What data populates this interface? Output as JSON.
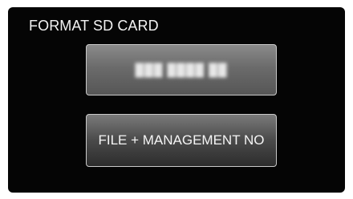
{
  "screen": {
    "title": "FORMAT SD CARD"
  },
  "menu": {
    "option_top": {
      "label": "███ ████ ██",
      "obscured": true
    },
    "option_bottom": {
      "label": "FILE + MANAGEMENT NO"
    }
  }
}
